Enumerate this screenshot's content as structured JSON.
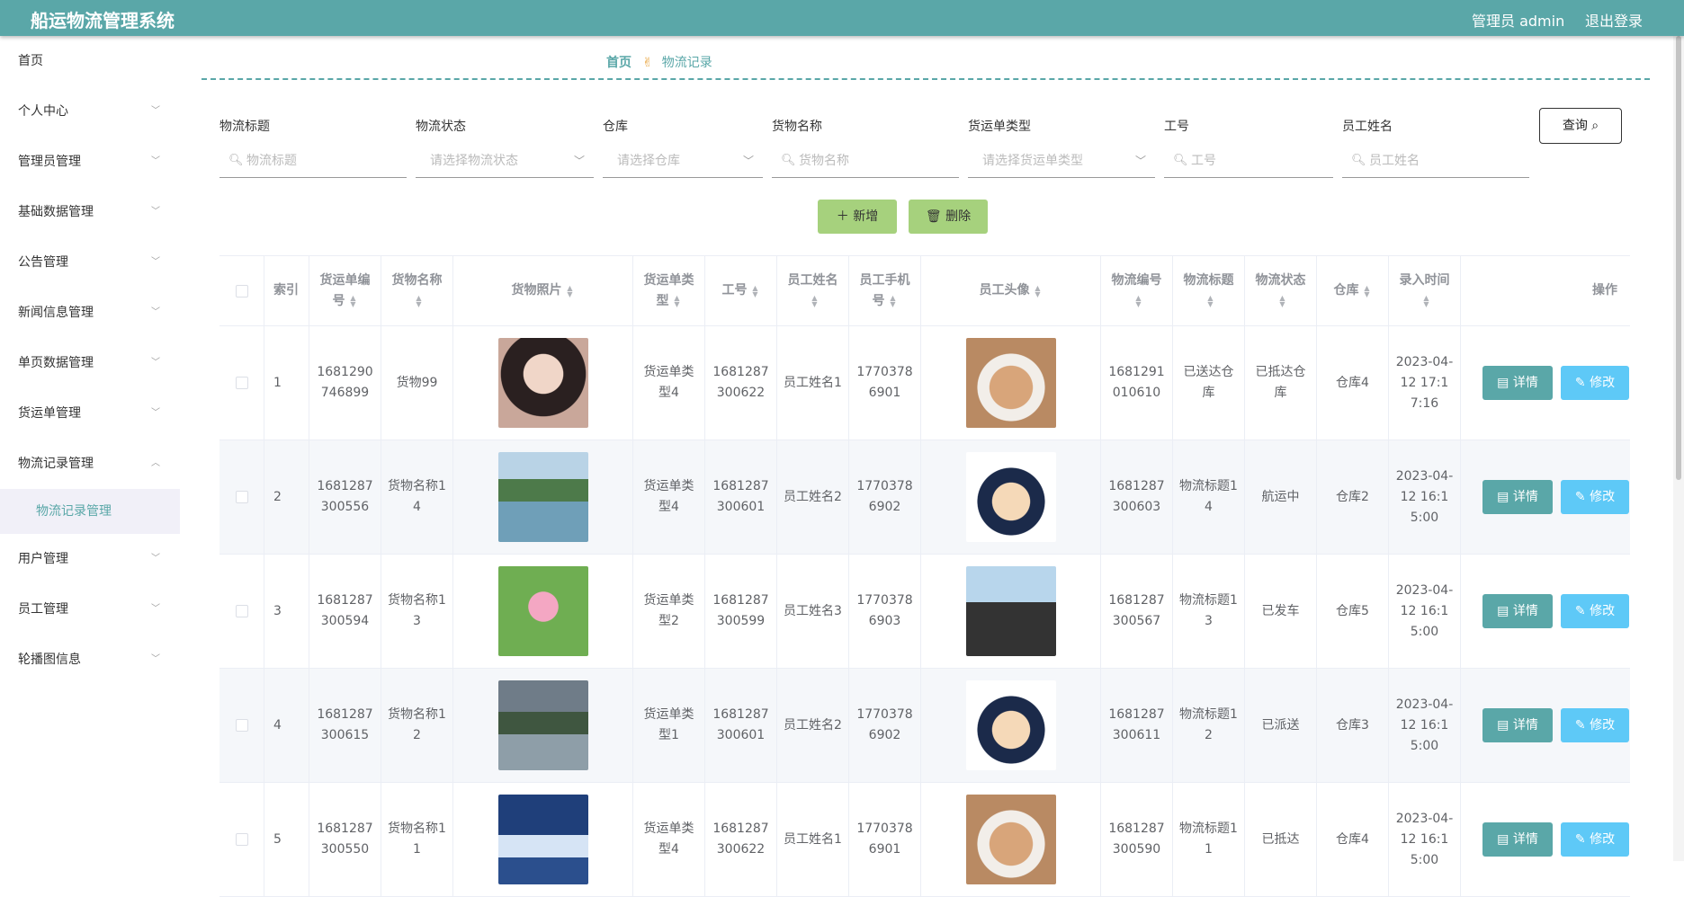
{
  "app": {
    "title": "船运物流管理系统",
    "user": "管理员 admin",
    "logout": "退出登录"
  },
  "sidebar": {
    "items": [
      {
        "label": "首页"
      },
      {
        "label": "个人中心"
      },
      {
        "label": "管理员管理"
      },
      {
        "label": "基础数据管理"
      },
      {
        "label": "公告管理"
      },
      {
        "label": "新闻信息管理"
      },
      {
        "label": "单页数据管理"
      },
      {
        "label": "货运单管理"
      },
      {
        "label": "物流记录管理"
      },
      {
        "label": "用户管理"
      },
      {
        "label": "员工管理"
      },
      {
        "label": "轮播图信息"
      }
    ],
    "sub": {
      "label": "物流记录管理"
    }
  },
  "breadcrumb": {
    "home": "首页",
    "current": "物流记录"
  },
  "filters": [
    {
      "label": "物流标题",
      "placeholder": "物流标题"
    },
    {
      "label": "物流状态",
      "placeholder": "请选择物流状态"
    },
    {
      "label": "仓库",
      "placeholder": "请选择仓库"
    },
    {
      "label": "货物名称",
      "placeholder": "货物名称"
    },
    {
      "label": "货运单类型",
      "placeholder": "请选择货运单类型"
    },
    {
      "label": "工号",
      "placeholder": "工号"
    },
    {
      "label": "员工姓名",
      "placeholder": "员工姓名"
    }
  ],
  "buttons": {
    "query": "查询",
    "add": "新增",
    "delete": "删除",
    "detail": "详情",
    "edit": "修改"
  },
  "table": {
    "headers": {
      "index": "索引",
      "order_no": "货运单编号",
      "goods_name": "货物名称",
      "goods_photo": "货物照片",
      "order_type": "货运单类型",
      "emp_no": "工号",
      "emp_name": "员工姓名",
      "emp_phone": "员工手机号",
      "emp_avatar": "员工头像",
      "logistics_no": "物流编号",
      "logistics_title": "物流标题",
      "logistics_status": "物流状态",
      "warehouse": "仓库",
      "entry_time": "录入时间",
      "ops": "操作"
    },
    "rows": [
      {
        "index": "1",
        "order_no": "1681290746899",
        "goods_name": "货物99",
        "order_type": "货运单类型4",
        "emp_no": "1681287300622",
        "emp_name": "员工姓名1",
        "emp_phone": "17703786901",
        "logistics_no": "1681291010610",
        "logistics_title": "已送达仓库",
        "logistics_status": "已抵达仓库",
        "warehouse": "仓库4",
        "entry_time": "2023-04-12 17:17:16"
      },
      {
        "index": "2",
        "order_no": "1681287300556",
        "goods_name": "货物名称14",
        "order_type": "货运单类型4",
        "emp_no": "1681287300601",
        "emp_name": "员工姓名2",
        "emp_phone": "17703786902",
        "logistics_no": "1681287300603",
        "logistics_title": "物流标题14",
        "logistics_status": "航运中",
        "warehouse": "仓库2",
        "entry_time": "2023-04-12 16:15:00"
      },
      {
        "index": "3",
        "order_no": "1681287300594",
        "goods_name": "货物名称13",
        "order_type": "货运单类型2",
        "emp_no": "1681287300599",
        "emp_name": "员工姓名3",
        "emp_phone": "17703786903",
        "logistics_no": "1681287300567",
        "logistics_title": "物流标题13",
        "logistics_status": "已发车",
        "warehouse": "仓库5",
        "entry_time": "2023-04-12 16:15:00"
      },
      {
        "index": "4",
        "order_no": "1681287300615",
        "goods_name": "货物名称12",
        "order_type": "货运单类型1",
        "emp_no": "1681287300601",
        "emp_name": "员工姓名2",
        "emp_phone": "17703786902",
        "logistics_no": "1681287300611",
        "logistics_title": "物流标题12",
        "logistics_status": "已派送",
        "warehouse": "仓库3",
        "entry_time": "2023-04-12 16:15:00"
      },
      {
        "index": "5",
        "order_no": "1681287300550",
        "goods_name": "货物名称11",
        "order_type": "货运单类型4",
        "emp_no": "1681287300622",
        "emp_name": "员工姓名1",
        "emp_phone": "17703786901",
        "logistics_no": "1681287300590",
        "logistics_title": "物流标题11",
        "logistics_status": "已抵达",
        "warehouse": "仓库4",
        "entry_time": "2023-04-12 16:15:00"
      }
    ]
  }
}
